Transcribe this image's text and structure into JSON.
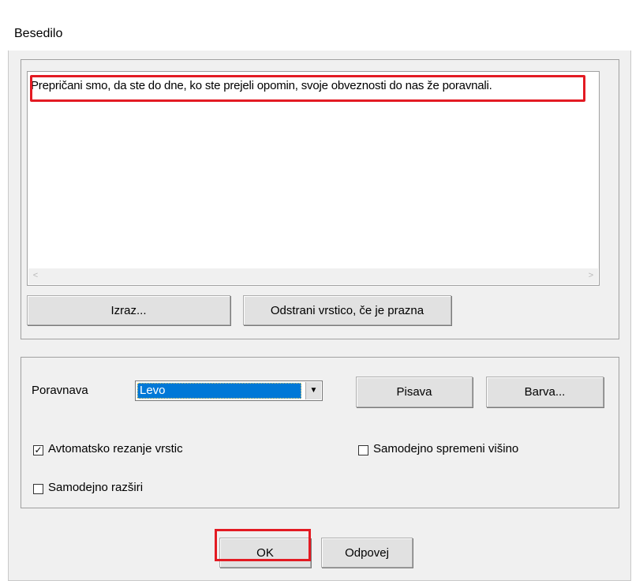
{
  "window": {
    "title": "Besedilo"
  },
  "text_area": {
    "content": "Prepričani smo, da ste do dne, ko ste prejeli opomin, svoje obveznosti do nas že poravnali.",
    "scroll_left": "<",
    "scroll_right": ">"
  },
  "buttons": {
    "expression": "Izraz...",
    "remove_line": "Odstrani vrstico, če je prazna",
    "font": "Pisava",
    "color": "Barva...",
    "ok": "OK",
    "cancel": "Odpovej"
  },
  "alignment": {
    "label": "Poravnava",
    "selected": "Levo"
  },
  "checkboxes": {
    "auto_wrap": {
      "label": "Avtomatsko rezanje vrstic",
      "checked": true
    },
    "auto_height": {
      "label": "Samodejno spremeni višino",
      "checked": false
    },
    "auto_expand": {
      "label": "Samodejno razširi",
      "checked": false
    }
  },
  "colors": {
    "highlight": "#e31b23",
    "selection": "#0078d7"
  }
}
